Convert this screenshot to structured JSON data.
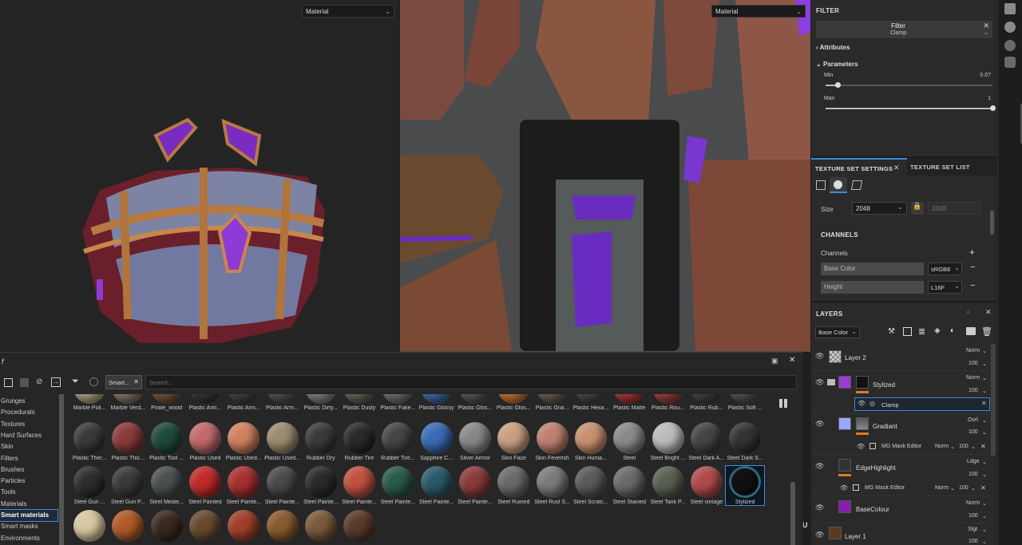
{
  "viewport3d": {
    "material_select": "Material"
  },
  "viewport2d": {
    "material_select": "Material"
  },
  "filter_panel": {
    "title": "FILTER",
    "filter_name": "Filter",
    "filter_value": "Clamp",
    "attributes_label": "Attributes",
    "parameters_label": "Parameters",
    "min_label": "Min",
    "min_value": "0.07",
    "min_fraction": 0.07,
    "max_label": "Max",
    "max_value": "1",
    "max_fraction": 1.0
  },
  "texture_set": {
    "tab1": "TEXTURE SET SETTINGS",
    "tab2": "TEXTURE SET LIST",
    "size_label": "Size",
    "size_value": "2048",
    "size_readonly": "2048",
    "channels_title": "CHANNELS",
    "channels_label": "Channels",
    "channel_list": [
      {
        "name": "Base Color",
        "format": "sRGB8"
      },
      {
        "name": "Height",
        "format": "L16F"
      }
    ]
  },
  "layers_panel": {
    "title": "LAYERS",
    "channel_select": "Base Color",
    "layers": [
      {
        "name": "Layer 2",
        "blend": "Norm",
        "opacity": "100"
      },
      {
        "name": "Stylized",
        "blend": "Norm",
        "opacity": "100",
        "effect": "Clamp"
      },
      {
        "name": "Gradiant",
        "blend": "Ovrl",
        "opacity": "100",
        "effect": "MG Mask Editor",
        "effect_blend": "Norm",
        "effect_opacity": "100"
      },
      {
        "name": "EdgeHighlight",
        "blend": "Ldge",
        "opacity": "100",
        "effect": "MG Mask Editor",
        "effect_blend": "Norm",
        "effect_opacity": "100"
      },
      {
        "name": "BaseColour",
        "blend": "Norm",
        "opacity": "100"
      },
      {
        "name": "Layer 1",
        "blend": "Slgt",
        "opacity": "100"
      }
    ]
  },
  "shelf": {
    "title": "f",
    "search_tag": "Smart...",
    "search_placeholder": "Search...",
    "categories": [
      "Grunges",
      "Procedurals",
      "Textures",
      "Hard Surfaces",
      "Skin",
      "Filters",
      "Brushes",
      "Particles",
      "Tools",
      "Materials",
      "Smart materials",
      "Smart masks",
      "Environments"
    ],
    "selected_category": "Smart materials",
    "row0": [
      "Marble Poli...",
      "Marble Verd...",
      "Pirate_wood",
      "Plastic Arm...",
      "Plastic Arm...",
      "Plastic Arm...",
      "Plastic Dirty...",
      "Plastic Dusty",
      "Plastic Fake...",
      "Plastic Glossy",
      "Plastic Glos...",
      "Plastic Glos...",
      "Plastic Grai...",
      "Plastic Hexa...",
      "Plastic Matte",
      "Plastic Rou...",
      "Plastic Rub...",
      "Plastic Soft ..."
    ],
    "row1": [
      "Plastic Ther...",
      "Plastic Thic...",
      "Plastic Tool ...",
      "Plastic Used",
      "Plastic Used...",
      "Plastic Used...",
      "Rubber Dry",
      "Rubber Tire",
      "Rubber Tire...",
      "Sapphire C...",
      "Silver Armor",
      "Skin Face",
      "Skin Feverish",
      "Skin Huma...",
      "Steel",
      "Steel Bright ...",
      "Steel Dark A...",
      "Steel Dark S..."
    ],
    "row2": [
      "Steel Gun ...",
      "Steel Gun P...",
      "Steel Medie...",
      "Steel Painted",
      "Steel Painte...",
      "Steel Painte...",
      "Steel Painte...",
      "Steel Painte...",
      "Steel Painte...",
      "Steel Painte...",
      "Steel Painte...",
      "Steel Ruined",
      "Steel Rust S...",
      "Steel Scratc...",
      "Steel Stained",
      "Steel Tank P...",
      "Steel vintage",
      "Stylized"
    ],
    "row0_colors": [
      "#b6a888",
      "#8a7a66",
      "#7a5a3a",
      "#3a3a3a",
      "#444",
      "#555",
      "#8a8a82",
      "#6a6a60",
      "#777",
      "#3a6fb0",
      "#5a5a5a",
      "#c77a3a",
      "#6b6250",
      "#444a50",
      "#b03a3a",
      "#a04040",
      "#444",
      "#555"
    ],
    "row1_colors": [
      "#3a3a3a",
      "#8a3a3a",
      "#1e4a3a",
      "#c26a6a",
      "#d08060",
      "#9a8c70",
      "#3a3a3a",
      "#2a2a2a",
      "#454545",
      "#3a6bb5",
      "#888",
      "#c8a080",
      "#c08070",
      "#c89070",
      "#8a8a8a",
      "#bcbcbc",
      "#444",
      "#333"
    ],
    "row2_colors": [
      "#2e2e2e",
      "#3a3a3a",
      "#4a5050",
      "#c02a2a",
      "#a83030",
      "#4a4a4a",
      "#2a2a2a",
      "#c05040",
      "#2a5a4a",
      "#2a5a6a",
      "#8a3a3a",
      "#6a6a6a",
      "#7a7a7a",
      "#5a5a5a",
      "#6a6a6a",
      "#5a6050",
      "#b04a4a",
      "#111"
    ],
    "row3_colors": [
      "#d8c8a0",
      "#b05a2a",
      "#3a2a20",
      "#6a4a30",
      "#a0402a",
      "#8a5a30",
      "#7a5a3a",
      "#5a3a2a"
    ]
  }
}
